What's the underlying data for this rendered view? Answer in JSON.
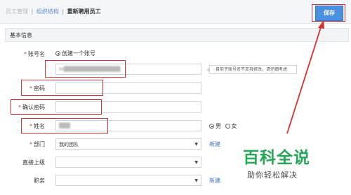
{
  "breadcrumb": {
    "items": [
      "员工管理",
      "组织结构"
    ],
    "separator": "|",
    "current": "重新聘用员工"
  },
  "toolbar": {
    "save_label": "保存"
  },
  "section": {
    "title": "基本信息"
  },
  "form": {
    "account_name": {
      "label": "账号名",
      "radio_label": "创建一个账号",
      "value": "m▒▒▒▒▒▒▒▒▒▒▒▒▒▒▒",
      "hint": "目前子账号名不支持修改，请仔细考虑"
    },
    "password": {
      "label": "密码",
      "value": ""
    },
    "confirm_password": {
      "label": "确认密码",
      "value": ""
    },
    "name": {
      "label": "姓名",
      "value": "▒▒▒",
      "gender_options": [
        "男",
        "女"
      ],
      "gender_selected": "男"
    },
    "department": {
      "label": "部门",
      "value": "我的团队",
      "new_link": "新建"
    },
    "superior": {
      "label": "直接上级",
      "value": ""
    },
    "position": {
      "label": "职务",
      "value": "",
      "new_link": "新建"
    }
  },
  "watermark": {
    "title": "百科全说",
    "subtitle": "助你轻松解决"
  },
  "colors": {
    "accent": "#4a90e2",
    "annotation": "#d9302e",
    "watermark": "#23a855"
  }
}
